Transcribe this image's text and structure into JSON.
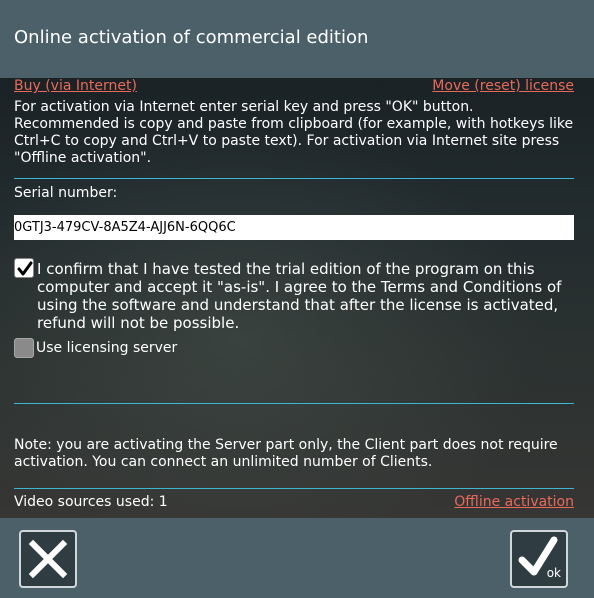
{
  "window": {
    "title": "Online activation of commercial edition"
  },
  "links": {
    "buy": "Buy (via Internet)",
    "move": "Move (reset) license",
    "offline": "Offline activation"
  },
  "description": "For activation via Internet enter serial key and press \"OK\" button. Recommended is copy and paste from clipboard (for example, with hotkeys like Ctrl+C to copy and Ctrl+V to paste text). For activation via Internet site press \"Offline activation\".",
  "serial": {
    "label": "Serial number:",
    "value": "0GTJ3-479CV-8A5Z4-AJJ6N-6QQ6C"
  },
  "confirm": {
    "checked": true,
    "text": "I confirm that I have tested the trial edition of the program on this computer and accept it \"as-is\". I agree to the Terms and Conditions of using the software and understand that after the license is activated, refund will not be possible."
  },
  "licensing_server": {
    "checked": false,
    "label": "Use licensing server"
  },
  "note": "Note: you are activating the Server part only, the Client part does not require activation. You can connect an unlimited number of Clients.",
  "video_sources": "Video sources used: 1",
  "buttons": {
    "cancel_icon": "close-icon",
    "ok_icon": "checkmark-icon",
    "ok_label": "ok"
  },
  "colors": {
    "header": "#4b6068",
    "link": "#e86a5a",
    "rule": "#3fb6cf"
  }
}
